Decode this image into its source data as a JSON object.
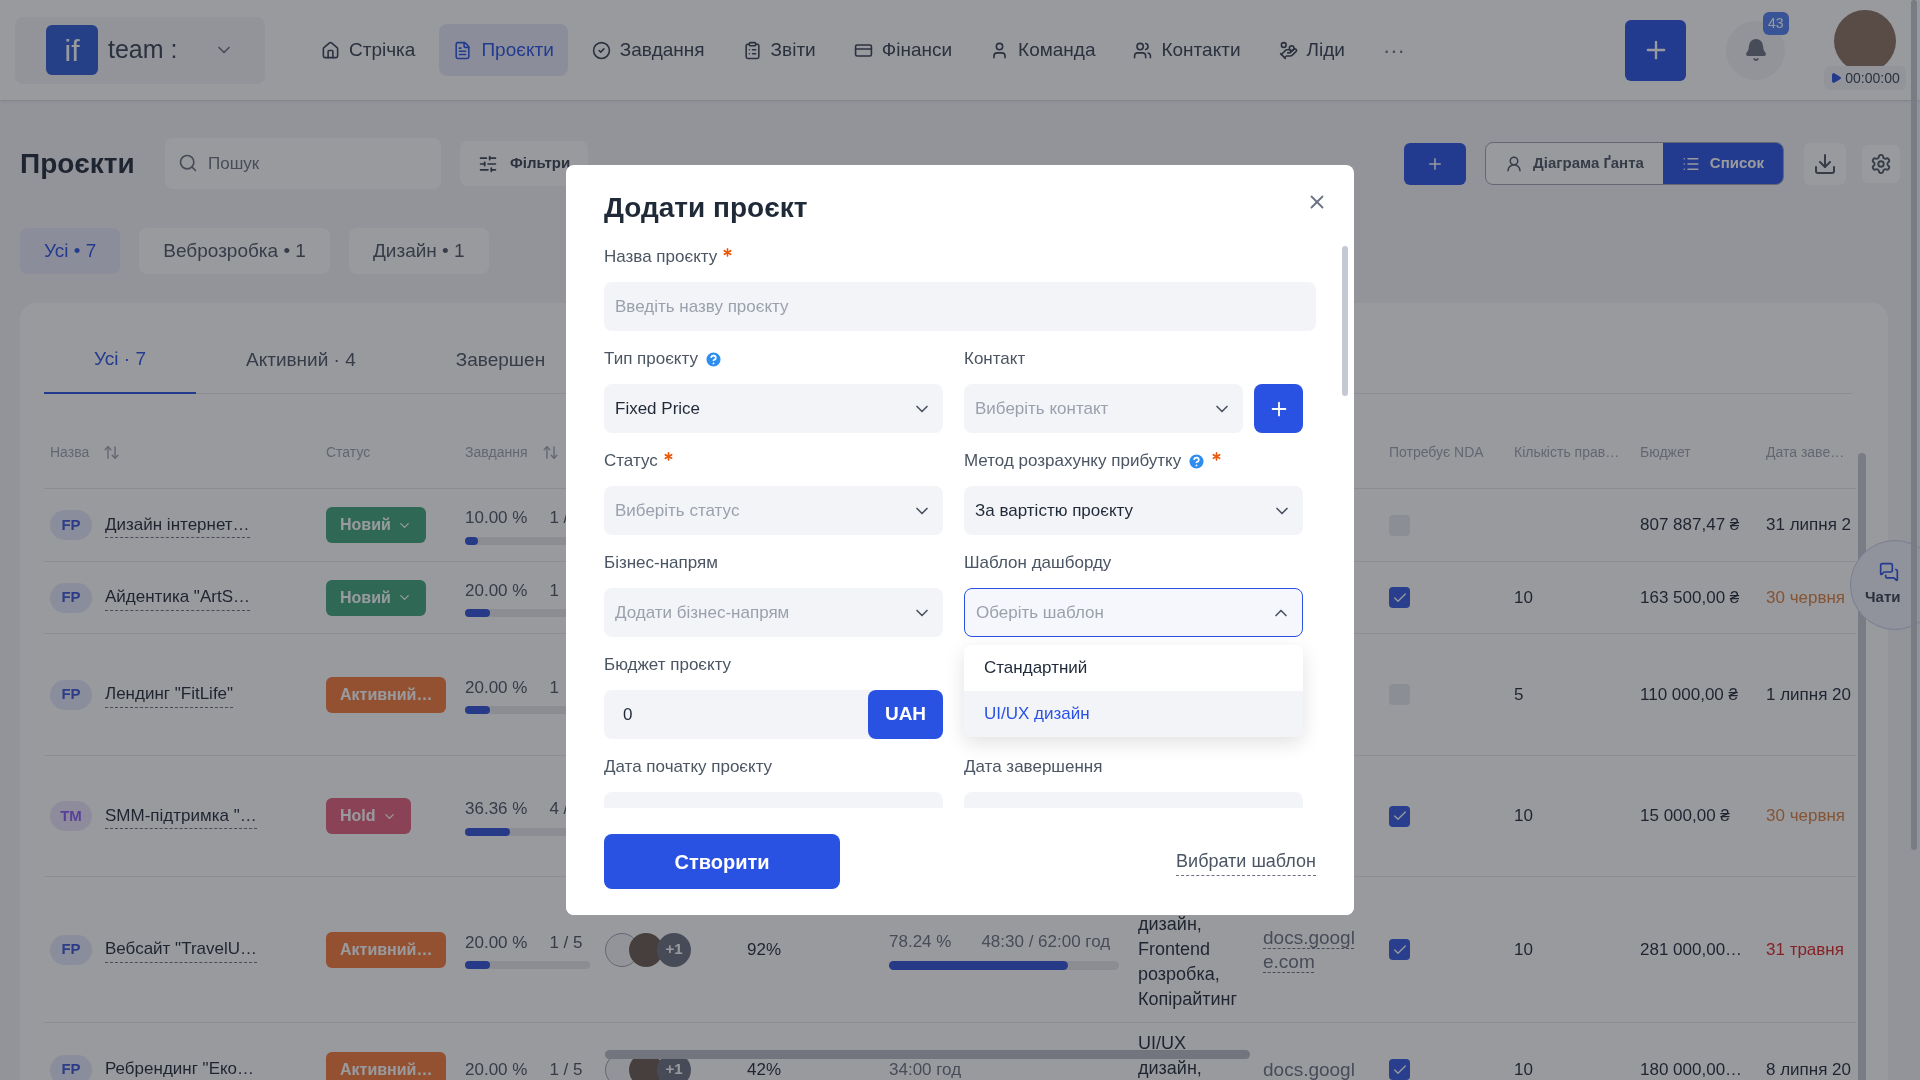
{
  "topbar": {
    "logo": "if",
    "workspace": "team :",
    "nav": [
      {
        "label": "Стрічка",
        "selected": false
      },
      {
        "label": "Проєкти",
        "selected": true
      },
      {
        "label": "Завдання",
        "selected": false
      },
      {
        "label": "Звіти",
        "selected": false
      },
      {
        "label": "Фінанси",
        "selected": false
      },
      {
        "label": "Команда",
        "selected": false
      },
      {
        "label": "Контакти",
        "selected": false
      },
      {
        "label": "Ліди",
        "selected": false
      }
    ],
    "more": "···",
    "notifications": "43",
    "timer": "00:00:00"
  },
  "page": {
    "title": "Проєкти",
    "search": {
      "placeholder": "Пошук"
    },
    "filters": "Фільтри",
    "views": [
      {
        "label": "Діаграма Ґанта",
        "selected": false
      },
      {
        "label": "Список",
        "selected": true
      }
    ]
  },
  "categories": [
    {
      "label": "Усі • 7",
      "selected": true
    },
    {
      "label": "Веброзробка • 1",
      "selected": false
    },
    {
      "label": "Дизайн • 1",
      "selected": false
    }
  ],
  "tabs": [
    {
      "label": "Усі · 7",
      "selected": true
    },
    {
      "label": "Активний · 4",
      "selected": false
    },
    {
      "label": "Завершен",
      "selected": false
    }
  ],
  "table": {
    "columns": [
      {
        "label": "Назва",
        "sortable": true
      },
      {
        "label": "Статус"
      },
      {
        "label": "Завдання",
        "sortable": true
      },
      {
        "label": "Потребує NDA"
      },
      {
        "label": "Кількість прав…"
      },
      {
        "label": "Бюджет"
      },
      {
        "label": "Дата заве…"
      }
    ],
    "rows": [
      {
        "type": {
          "label": "FP",
          "kind": "fixed"
        },
        "name": "Дизайн інтернет…",
        "status": {
          "label": "Новий",
          "kind": "new"
        },
        "progress": {
          "percent": "10.00 %",
          "count": "1 /",
          "level": 0.1
        },
        "nda": false,
        "budget": "807 887,47 ₴",
        "deadline": {
          "date": "31 липня 2",
          "kind": "normal"
        }
      },
      {
        "type": {
          "label": "FP",
          "kind": "fixed"
        },
        "name": "Айдентика \"ArtS…",
        "status": {
          "label": "Новий",
          "kind": "new"
        },
        "progress": {
          "percent": "20.00 %",
          "count": "1",
          "level": 0.2
        },
        "nda": true,
        "revisions": "10",
        "budget": "163 500,00 ₴",
        "deadline": {
          "date": "30 червня",
          "kind": "warning"
        }
      },
      {
        "type": {
          "label": "FP",
          "kind": "fixed"
        },
        "name": "Лендинг \"FitLife\"",
        "status": {
          "label": "Активний…",
          "kind": "active"
        },
        "progress": {
          "percent": "20.00 %",
          "count": "1",
          "level": 0.2
        },
        "nda": false,
        "revisions": "5",
        "budget": "110 000,00 ₴",
        "deadline": {
          "date": "1 липня 20",
          "kind": "normal"
        }
      },
      {
        "type": {
          "label": "TM",
          "kind": "time"
        },
        "name": "SMM-підтримка \"…",
        "status": {
          "label": "Hold",
          "kind": "hold"
        },
        "progress": {
          "percent": "36.36 %",
          "count": "4 /",
          "level": 0.36
        },
        "nda": true,
        "revisions": "10",
        "budget": "15 000,00 ₴",
        "deadline": {
          "date": "30 червня",
          "kind": "warning"
        }
      },
      {
        "type": {
          "label": "FP",
          "kind": "fixed"
        },
        "name": "Вебсайт \"TravelU…",
        "status": {
          "label": "Активний…",
          "kind": "active"
        },
        "progress": {
          "percent": "20.00 %",
          "count": "1 / 5",
          "level": 0.2
        },
        "team_extra": "+1",
        "completion": "92%",
        "time": {
          "share": "78.24 %",
          "hours": "48:30 / 62:00 год",
          "level": 0.78
        },
        "services": "дизайн, Frontend розробка, Копірайтинг",
        "docs": "docs.google.com",
        "nda": true,
        "revisions": "10",
        "budget": "281 000,00…",
        "deadline": {
          "date": "31 травня",
          "kind": "overdue"
        }
      },
      {
        "type": {
          "label": "FP",
          "kind": "fixed"
        },
        "name": "Ребрендинг \"Еко…",
        "status": {
          "label": "Активний…",
          "kind": "active"
        },
        "progress": {
          "percent": "20.00 %",
          "count": "1 / 5"
        },
        "team_extra": "+1",
        "completion": "42%",
        "time": {
          "hours": "34:00 год"
        },
        "services": "UI/UX дизайн,",
        "docs": "docs.googl",
        "nda": true,
        "revisions": "10",
        "budget": "180 000,00…",
        "deadline": {
          "date": "8 липня 20",
          "kind": "normal"
        }
      }
    ]
  },
  "modal": {
    "title": "Додати проєкт",
    "rows": [
      {
        "fields": [
          {
            "kind": "text",
            "label": "Назва проєкту",
            "required": true,
            "wide": true,
            "placeholder": "Введіть назву проєкту"
          }
        ]
      },
      {
        "fields": [
          {
            "kind": "select",
            "label": "Тип проєкту",
            "help": true,
            "value": "Fixed Price",
            "expanded": false
          },
          {
            "kind": "select_add",
            "label": "Контакт",
            "placeholder": "Виберіть контакт",
            "expanded": false
          }
        ]
      },
      {
        "fields": [
          {
            "kind": "select",
            "label": "Статус",
            "required": true,
            "placeholder": "Виберіть статус",
            "expanded": false
          },
          {
            "kind": "select",
            "label": "Метод розрахунку прибутку",
            "required": true,
            "help": true,
            "value": "За вартістю проєкту",
            "expanded": false
          }
        ]
      },
      {
        "fields": [
          {
            "kind": "select",
            "label": "Бізнес-напрям",
            "placeholder": "Додати бізнес-напрям",
            "expanded": false
          },
          {
            "kind": "select",
            "label": "Шаблон дашборду",
            "placeholder": "Оберіть шаблон",
            "expanded": true
          }
        ]
      },
      {
        "fields": [
          {
            "kind": "money",
            "label": "Бюджет проєкту",
            "value": "0",
            "currency": "UAH"
          }
        ]
      },
      {
        "fields": [
          {
            "kind": "date",
            "label": "Дата початку проєкту"
          },
          {
            "kind": "date",
            "label": "Дата завершення"
          }
        ]
      }
    ],
    "dropdown": {
      "options": [
        {
          "label": "Стандартний",
          "selected": false
        },
        {
          "label": "UI/UX дизайн",
          "selected": true
        }
      ]
    },
    "submit": "Створити",
    "template_link": "Вибрати шаблон"
  },
  "chats": {
    "label": "Чати"
  }
}
